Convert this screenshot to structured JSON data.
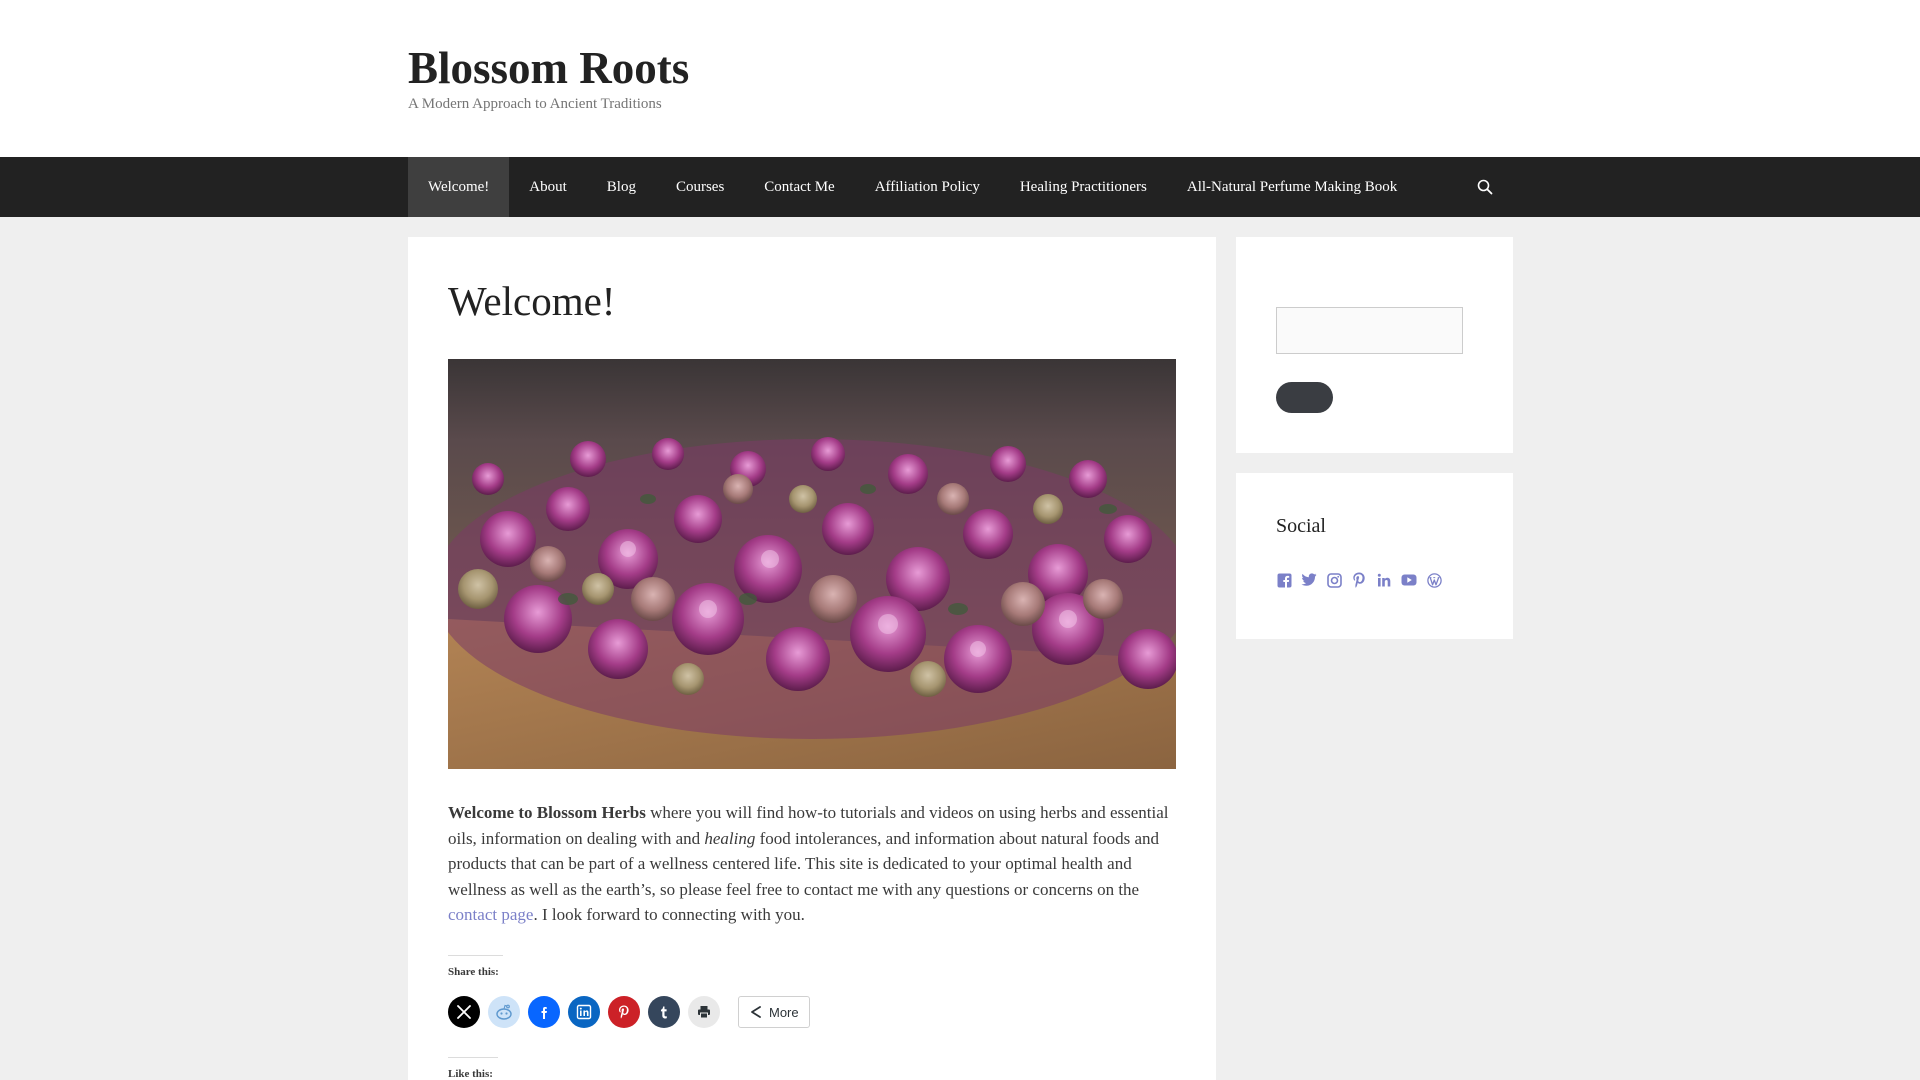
{
  "header": {
    "site_title": "Blossom Roots",
    "tagline": "A Modern Approach to Ancient Traditions"
  },
  "nav": {
    "items": [
      {
        "label": "Welcome!",
        "active": true
      },
      {
        "label": "About"
      },
      {
        "label": "Blog"
      },
      {
        "label": "Courses"
      },
      {
        "label": "Contact Me"
      },
      {
        "label": "Affiliation Policy"
      },
      {
        "label": "Healing Practitioners"
      },
      {
        "label": "All-Natural Perfume Making Book"
      }
    ],
    "search_icon": "search-icon"
  },
  "main": {
    "title": "Welcome!",
    "image_subject": "dried rose buds and petals on a wooden board",
    "intro": {
      "bold": "Welcome to Blossom Herbs",
      "part1": " where you will find how-to tutorials and videos on using herbs and essential oils, information on dealing with and ",
      "italic": "healing",
      "part2": " food intolerances, and information about natural foods and products that can be part of a wellness centered life. This site is dedicated to your optimal health and wellness as well as the earth’s, so please feel free to contact me with any questions or concerns on the ",
      "link": "contact page",
      "part3": ". I look forward to connecting with you."
    },
    "share_heading": "Share this:",
    "share_buttons": [
      {
        "icon": "x-icon",
        "color": "#000000"
      },
      {
        "icon": "reddit-icon",
        "color": "#cee3f8"
      },
      {
        "icon": "facebook-icon",
        "color": "#0866ff"
      },
      {
        "icon": "linkedin-icon",
        "color": "#0a66c2"
      },
      {
        "icon": "pinterest-icon",
        "color": "#cc2127"
      },
      {
        "icon": "tumblr-icon",
        "color": "#35465c"
      },
      {
        "icon": "print-icon",
        "color": "#e9e9e9"
      }
    ],
    "more_label": "More",
    "like_heading": "Like this:"
  },
  "sidebar": {
    "search": {
      "placeholder": ""
    },
    "social": {
      "title": "Social",
      "icons": [
        "facebook-icon",
        "twitter-icon",
        "instagram-icon",
        "pinterest-icon",
        "linkedin-icon",
        "youtube-icon",
        "wordpress-icon"
      ],
      "color": "#7b80c8"
    }
  },
  "colors": {
    "nav_bg": "#222222",
    "nav_active_bg": "#3f3f3f",
    "link": "#7b80c8",
    "page_bg": "#efefef"
  }
}
